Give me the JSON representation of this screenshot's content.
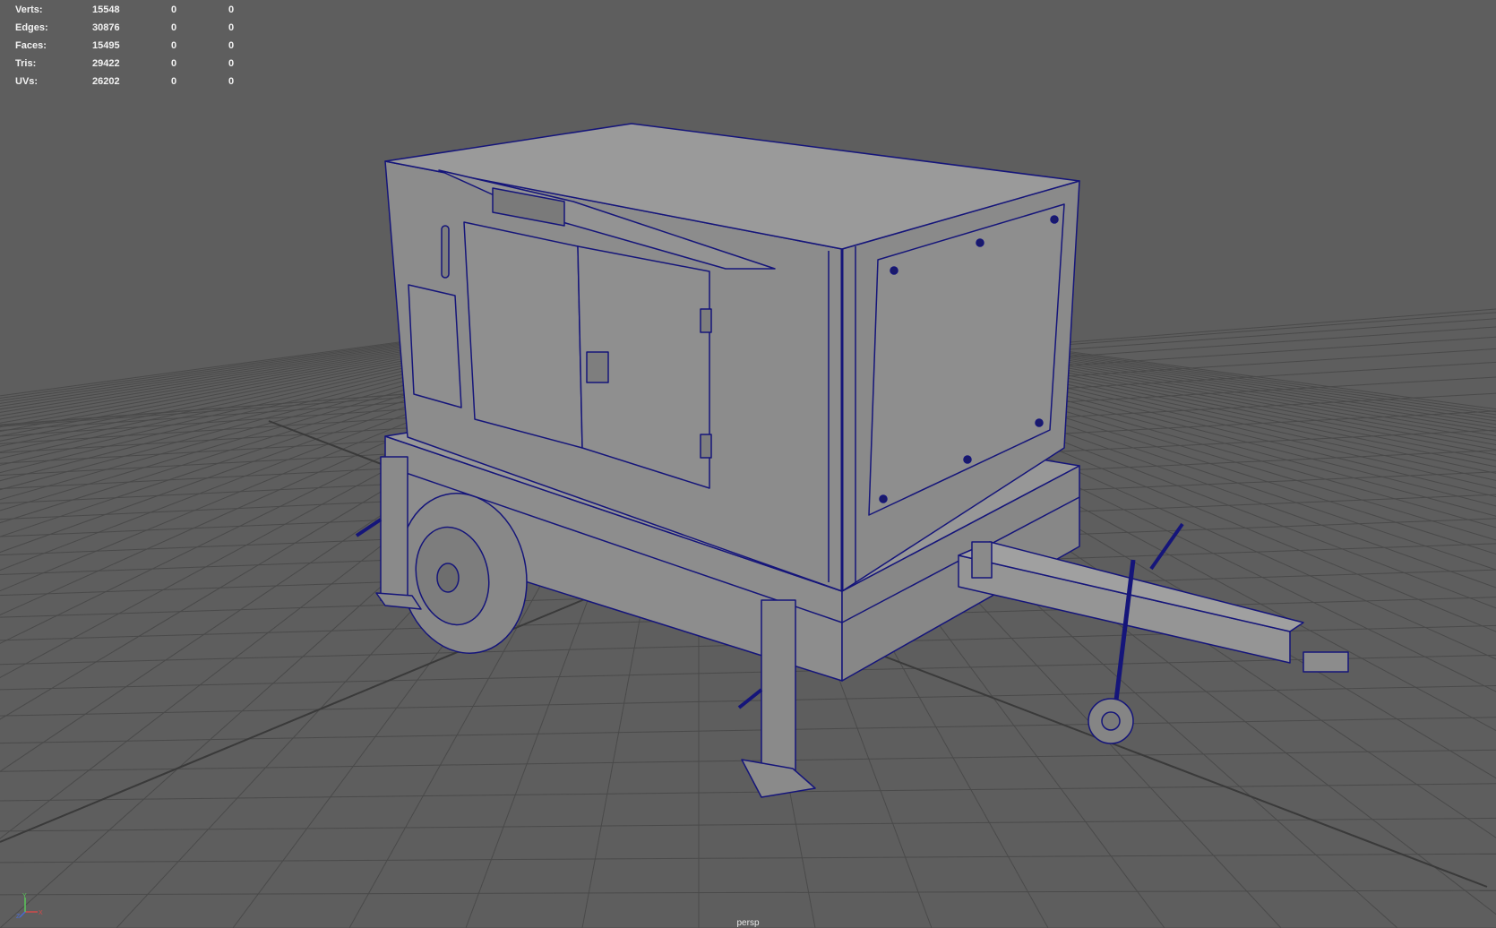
{
  "viewport": {
    "camera": "persp",
    "background": "#5e5e5e",
    "grid_color": "#494949",
    "wire_color": "#15157a",
    "model_fill": "#909090"
  },
  "hud": {
    "rows": [
      {
        "label": "Verts:",
        "total": "15548",
        "selected": "0",
        "component": "0"
      },
      {
        "label": "Edges:",
        "total": "30876",
        "selected": "0",
        "component": "0"
      },
      {
        "label": "Faces:",
        "total": "15495",
        "selected": "0",
        "component": "0"
      },
      {
        "label": "Tris:",
        "total": "29422",
        "selected": "0",
        "component": "0"
      },
      {
        "label": "UVs:",
        "total": "26202",
        "selected": "0",
        "component": "0"
      }
    ]
  },
  "axis": {
    "x": "X",
    "y": "Y",
    "z": "Z",
    "x_color": "#d24a4a",
    "y_color": "#5ac85a",
    "z_color": "#4a6ad2"
  }
}
